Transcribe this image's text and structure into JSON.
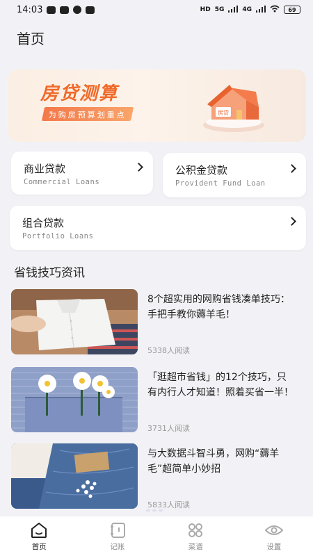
{
  "status_bar": {
    "time": "14:03",
    "network_labels": [
      "HD",
      "5G",
      "4G"
    ],
    "battery": "69"
  },
  "page_title": "首页",
  "banner": {
    "title": "房贷测算",
    "subtitle": "为购房预算划重点",
    "house_sign": "房贷",
    "accent": "#f06a2a"
  },
  "loans": [
    {
      "title": "商业贷款",
      "subtitle": "Commercial Loans"
    },
    {
      "title": "公积金贷款",
      "subtitle": "Provident Fund Loan"
    },
    {
      "title": "组合贷款",
      "subtitle": "Portfolio Loans"
    }
  ],
  "section_title": "省钱技巧资讯",
  "articles": [
    {
      "title": "8个超实用的网购省钱凑单技巧：手把手教你薅羊毛！",
      "reads": "5338人阅读",
      "image": "folded-shirt"
    },
    {
      "title": "「逛超市省钱」的12个技巧，只有内行人才知道！照着买省一半！",
      "reads": "3731人阅读",
      "image": "daisies-on-pocket"
    },
    {
      "title": "与大数据斗智斗勇，网购“薅羊毛”超简单小妙招",
      "reads": "5833人阅读",
      "image": "jeans-flowers"
    }
  ],
  "tabs": [
    {
      "label": "首页",
      "icon": "home-icon",
      "active": true
    },
    {
      "label": "记账",
      "icon": "notebook-icon",
      "active": false
    },
    {
      "label": "菜谱",
      "icon": "grid-icon",
      "active": false
    },
    {
      "label": "设置",
      "icon": "eye-icon",
      "active": false
    }
  ]
}
